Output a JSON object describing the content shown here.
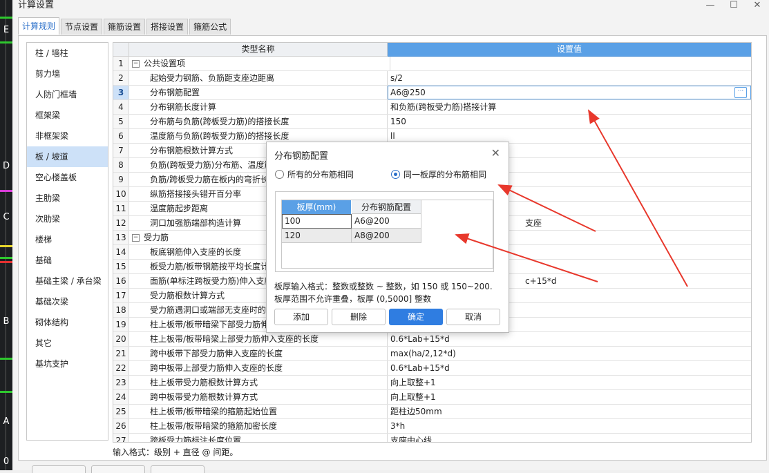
{
  "cad_axis_labels": [
    "E",
    "D",
    "C",
    "B",
    "A",
    "0"
  ],
  "window": {
    "title": "计算设置",
    "minimize": "—",
    "maximize": "☐",
    "close": "✕"
  },
  "tabs": [
    "计算规则",
    "节点设置",
    "箍筋设置",
    "搭接设置",
    "箍筋公式"
  ],
  "sidebar": {
    "items": [
      "柱 / 墙柱",
      "剪力墙",
      "人防门框墙",
      "框架梁",
      "非框架梁",
      "板 / 坡道",
      "空心楼盖板",
      "主肋梁",
      "次肋梁",
      "楼梯",
      "基础",
      "基础主梁 / 承台梁",
      "基础次梁",
      "砌体结构",
      "其它",
      "基坑支护"
    ],
    "active_index": 5
  },
  "grid": {
    "header_name": "类型名称",
    "header_value": "设置值",
    "rows": [
      {
        "num": "1",
        "group": true,
        "name": "公共设置项",
        "value": ""
      },
      {
        "num": "2",
        "name": "起始受力钢筋、负筋距支座边距离",
        "value": "s/2"
      },
      {
        "num": "3",
        "name": "分布钢筋配置",
        "value": "A6@250",
        "selected": true
      },
      {
        "num": "4",
        "name": "分布钢筋长度计算",
        "value": "和负筋(跨板受力筋)搭接计算"
      },
      {
        "num": "5",
        "name": "分布筋与负筋(跨板受力筋)的搭接长度",
        "value": "150"
      },
      {
        "num": "6",
        "name": "温度筋与负筋(跨板受力筋)的搭接长度",
        "value": "ll"
      },
      {
        "num": "7",
        "name": "分布钢筋根数计算方式",
        "value": ""
      },
      {
        "num": "8",
        "name": "负筋(跨板受力筋)分布筋、温度筋",
        "value": ""
      },
      {
        "num": "9",
        "name": "负筋/跨板受力筋在板内的弯折长",
        "value": ""
      },
      {
        "num": "10",
        "name": "纵筋搭接接头错开百分率",
        "value": ""
      },
      {
        "num": "11",
        "name": "温度筋起步距离",
        "value": ""
      },
      {
        "num": "12",
        "name": "洞口加强筋端部构造计算",
        "value": "支座"
      },
      {
        "num": "13",
        "group": true,
        "name": "受力筋",
        "value": ""
      },
      {
        "num": "14",
        "name": "板底钢筋伸入支座的长度",
        "value": ""
      },
      {
        "num": "15",
        "name": "板受力筋/板带钢筋按平均长度计",
        "value": ""
      },
      {
        "num": "16",
        "name": "面筋(单标注跨板受力筋)伸入支座",
        "value": "c+15*d"
      },
      {
        "num": "17",
        "name": "受力筋根数计算方式",
        "value": ""
      },
      {
        "num": "18",
        "name": "受力筋遇洞口或端部无支座时的",
        "value": ""
      },
      {
        "num": "19",
        "name": "柱上板带/板带暗梁下部受力筋伸",
        "value": ""
      },
      {
        "num": "20",
        "name": "柱上板带/板带暗梁上部受力筋伸入支座的长度",
        "value": "0.6*Lab+15*d"
      },
      {
        "num": "21",
        "name": "跨中板带下部受力筋伸入支座的长度",
        "value": "max(ha/2,12*d)"
      },
      {
        "num": "22",
        "name": "跨中板带上部受力筋伸入支座的长度",
        "value": "0.6*Lab+15*d"
      },
      {
        "num": "23",
        "name": "柱上板带受力筋根数计算方式",
        "value": "向上取整+1"
      },
      {
        "num": "24",
        "name": "跨中板带受力筋根数计算方式",
        "value": "向上取整+1"
      },
      {
        "num": "25",
        "name": "柱上板带/板带暗梁的箍筋起始位置",
        "value": "距柱边50mm"
      },
      {
        "num": "26",
        "name": "柱上板带/板带暗梁的箍筋加密长度",
        "value": "3*h"
      },
      {
        "num": "27",
        "name": "跨板受力筋标注长度位置",
        "value": "支座中心线"
      }
    ]
  },
  "bottom_hint": "输入格式：级别 + 直径 @ 间距。",
  "dialog": {
    "title": "分布钢筋配置",
    "close": "✕",
    "radio_all": "所有的分布筋相同",
    "radio_same_thickness": "同一板厚的分布筋相同",
    "selected_radio": "same_thickness",
    "table_head_thickness": "板厚(mm)",
    "table_head_config": "分布钢筋配置",
    "table_rows": [
      {
        "thickness": "100",
        "config": "A6@200"
      },
      {
        "thickness": "120",
        "config": "A8@200"
      }
    ],
    "hint_line1": "板厚输入格式：整数或整数 ~ 整数，如 150 或 150~200.",
    "hint_line2": "板厚范围不允许重叠，板厚 (0,5000] 整数",
    "btn_add": "添加",
    "btn_delete": "删除",
    "btn_ok": "确定",
    "btn_cancel": "取消"
  },
  "colors": {
    "accent": "#2f7de1",
    "header_blue": "#5aa0e6",
    "arrow_red": "#e8382c",
    "sidebar_active": "#cde1f8"
  }
}
